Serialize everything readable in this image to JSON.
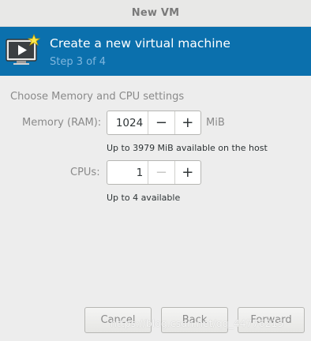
{
  "window": {
    "title": "New VM"
  },
  "header": {
    "title": "Create a new virtual machine",
    "step": "Step 3 of 4",
    "icon": "monitor-play-star-icon"
  },
  "section": {
    "title": "Choose Memory and CPU settings"
  },
  "memory": {
    "label": "Memory (RAM):",
    "value": "1024",
    "decrement": "−",
    "increment": "+",
    "unit": "MiB",
    "hint": "Up to 3979 MiB available on the host"
  },
  "cpus": {
    "label": "CPUs:",
    "value": "1",
    "decrement": "−",
    "increment": "+",
    "hint": "Up to 4 available"
  },
  "buttons": {
    "cancel": "Cancel",
    "back": "Back",
    "forward": "Forward"
  },
  "watermark": "https://blog.csdn.net/qq_44776215"
}
